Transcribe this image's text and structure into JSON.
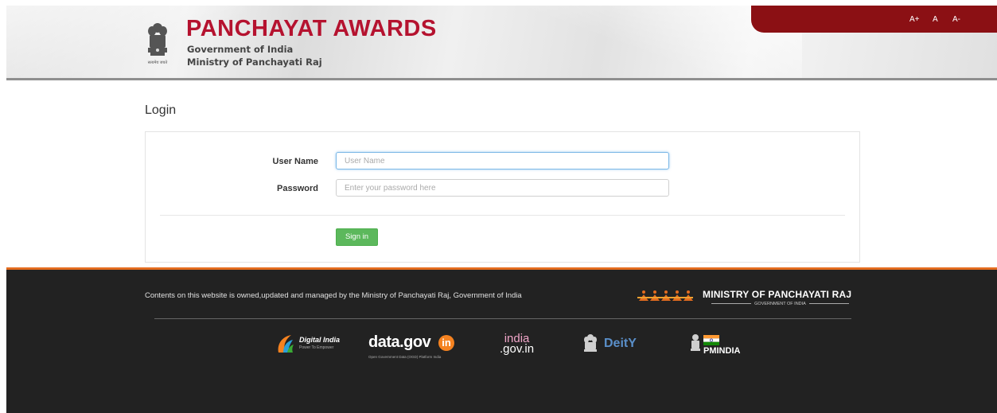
{
  "header": {
    "title": "PANCHAYAT AWARDS",
    "subtitle_line1": "Government of India",
    "subtitle_line2": "Ministry of Panchayati Raj",
    "emblem_caption": "सत्यमेव जयते",
    "font_controls": [
      "A+",
      "A",
      "A-"
    ],
    "accent_color": "#b5122f",
    "bar_color": "#8b1014"
  },
  "login": {
    "heading": "Login",
    "username_label": "User Name",
    "username_placeholder": "User Name",
    "username_value": "",
    "password_label": "Password",
    "password_placeholder": "Enter your password here",
    "password_value": "",
    "signin_label": "Sign in",
    "signin_color": "#5cb85c"
  },
  "footer": {
    "ownership_text": "Contents on this website is owned,updated and managed by the Ministry of Panchayati Raj, Government of India",
    "ministry_logo_title": "MINISTRY OF PANCHAYATI RAJ",
    "ministry_logo_subtitle": "GOVERNMENT OF INDIA",
    "partners": {
      "digital_india": {
        "name": "Digital India",
        "tagline": "Power To Empower"
      },
      "data_gov": {
        "name": "data.gov",
        "badge": "in",
        "tagline": "Open Government Data (OGD) Platform India"
      },
      "india_gov": {
        "line1": "india",
        "line2": ".gov.in"
      },
      "deity": {
        "name": "DeitY"
      },
      "pmindia": {
        "name": "PMINDIA"
      }
    },
    "border_color": "#e36c1f"
  }
}
